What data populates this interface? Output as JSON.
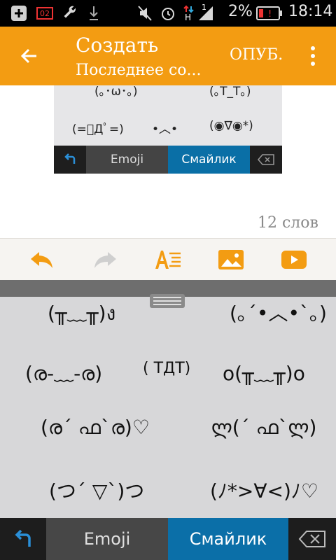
{
  "status_bar": {
    "notif_badge": "02",
    "battery_percent": "2%",
    "time": "18:14",
    "signal_badge": "1",
    "network_letter": "H"
  },
  "app_bar": {
    "title": "Создать",
    "subtitle": "Последнее со...",
    "publish_label": "ОПУБ.",
    "icons": {
      "back": "arrow-left-icon",
      "more": "more-vert-icon"
    }
  },
  "preview_image": {
    "kaomoji_rows": [
      {
        "left": "(｡･ω･｡)",
        "right": "(｡T_T｡)"
      },
      {
        "left": "(=ﾟДﾟ=)",
        "center": "•︿•",
        "right": "(◉∇◉*)"
      }
    ],
    "tabs": {
      "emoji": "Emoji",
      "smiley": "Смайлик"
    }
  },
  "word_count": "12 слов",
  "format_toolbar": {
    "icons": [
      "undo-icon",
      "redo-icon",
      "text-format-icon",
      "insert-image-icon",
      "insert-video-icon"
    ],
    "accent": "#f39c12",
    "disabled": "#cfcfcf"
  },
  "keyboard": {
    "kaomoji": [
      "(╥﹏╥)ง",
      "(｡´•︿•`｡)",
      "(ര-﹏-ര)",
      "( TДT)",
      "o(╥﹏╥)o",
      "(ര´ ഫ`ര)♡",
      "ლ(´ ഫ`ლ)",
      "(つ´ ▽`)つ",
      "(ﾉ*>∀<)ﾉ♡"
    ],
    "tabs": {
      "emoji": "Emoji",
      "smiley": "Смайлик"
    },
    "active_tab": "Смайлик",
    "active_color": "#0b6fa8"
  }
}
